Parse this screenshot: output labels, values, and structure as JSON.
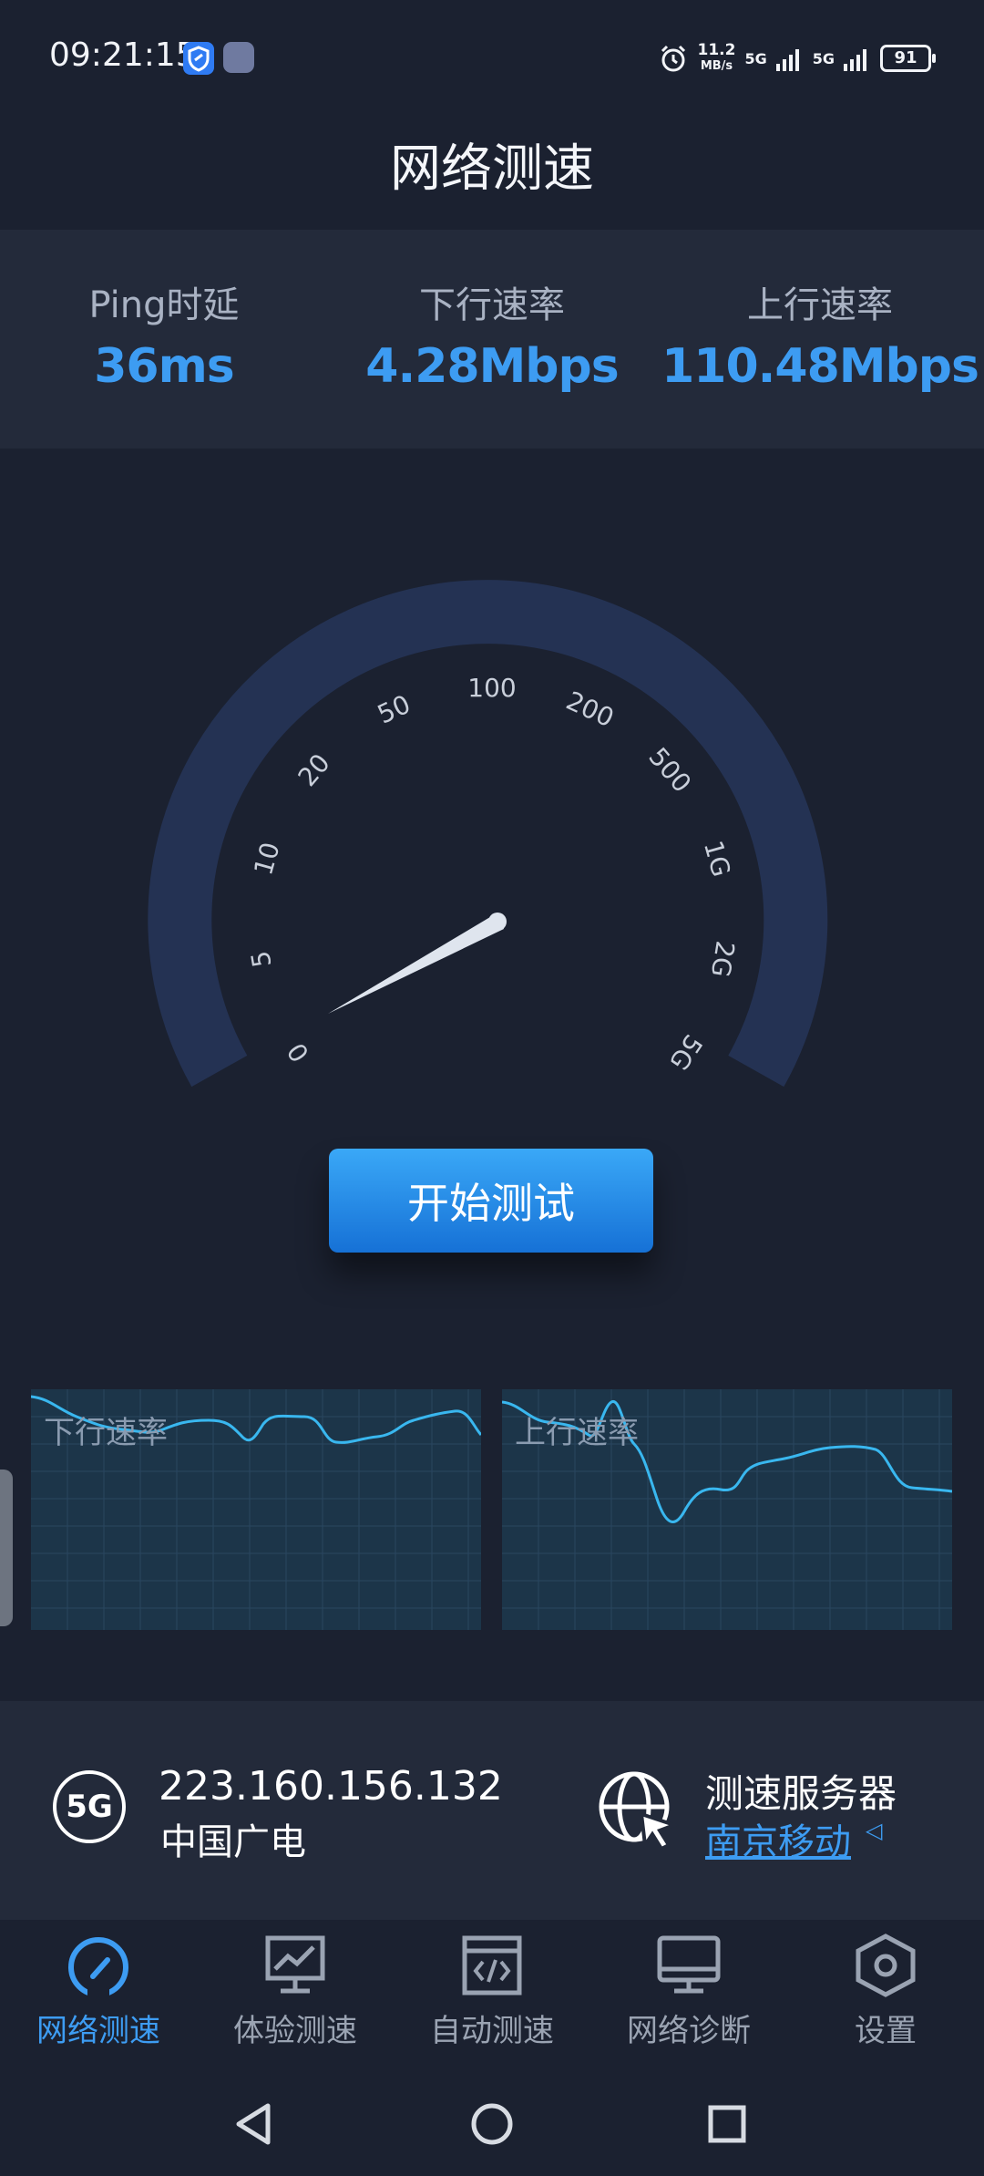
{
  "status_bar": {
    "time": "09:21:15",
    "net_speed_value": "11.2",
    "net_speed_unit": "MB/s",
    "network_1": "5G",
    "network_2": "5G",
    "battery": "91"
  },
  "page_title": "网络测速",
  "stats": [
    {
      "label": "Ping时延",
      "value": "36ms"
    },
    {
      "label": "下行速率",
      "value": "4.28Mbps"
    },
    {
      "label": "上行速率",
      "value": "110.48Mbps"
    }
  ],
  "gauge": {
    "scale_labels": [
      "0",
      "5",
      "10",
      "20",
      "50",
      "100",
      "200",
      "500",
      "1G",
      "2G",
      "5G"
    ],
    "needle_value": "4.28"
  },
  "start_button": "开始测试",
  "charts": {
    "download_label": "下行速率",
    "upload_label": "上行速率"
  },
  "network_info": {
    "network_type": "5G",
    "ip": "223.160.156.132",
    "isp": "中国广电",
    "server_title": "测速服务器",
    "server_name": "南京移动"
  },
  "bottom_nav": [
    {
      "label": "网络测速",
      "icon": "speedometer-icon",
      "active": true
    },
    {
      "label": "体验测速",
      "icon": "chart-monitor-icon",
      "active": false
    },
    {
      "label": "自动测速",
      "icon": "code-window-icon",
      "active": false
    },
    {
      "label": "网络诊断",
      "icon": "desktop-icon",
      "active": false
    },
    {
      "label": "设置",
      "icon": "settings-hexagon-icon",
      "active": false
    }
  ],
  "colors": {
    "background": "#1b2130",
    "panel": "#232a3a",
    "accent": "#3d9cf2",
    "gauge_arc": "#243253"
  }
}
